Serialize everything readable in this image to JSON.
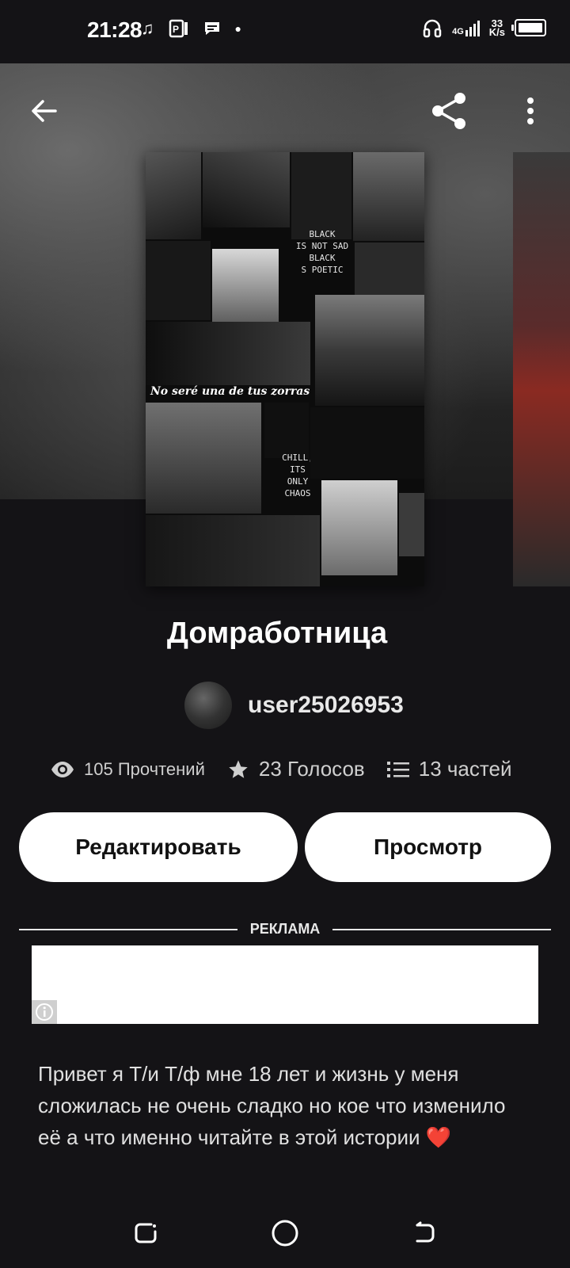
{
  "status_bar": {
    "time": "21:28",
    "network_type": "4G",
    "speed_value": "33",
    "speed_unit": "K/s"
  },
  "story": {
    "title": "Домработница",
    "author": "user25026953",
    "cover_text_1": "BLACK\nIS NOT SAD\nBLACK\nS POETIC",
    "cover_text_2": "No seré una de tus zorras",
    "cover_text_3": "CHILL,\nITS\nONLY\nCHAOS"
  },
  "stats": {
    "reads": "105 Прочтений",
    "votes": "23 Голосов",
    "parts": "13 частей"
  },
  "buttons": {
    "edit": "Редактировать",
    "view": "Просмотр"
  },
  "ad": {
    "label": "РЕКЛАМА"
  },
  "description": "Привет я Т/и Т/ф мне 18 лет и жизнь у меня сложилась не очень сладко но кое что изменило её а что именно читайте в этой истории ❤️"
}
